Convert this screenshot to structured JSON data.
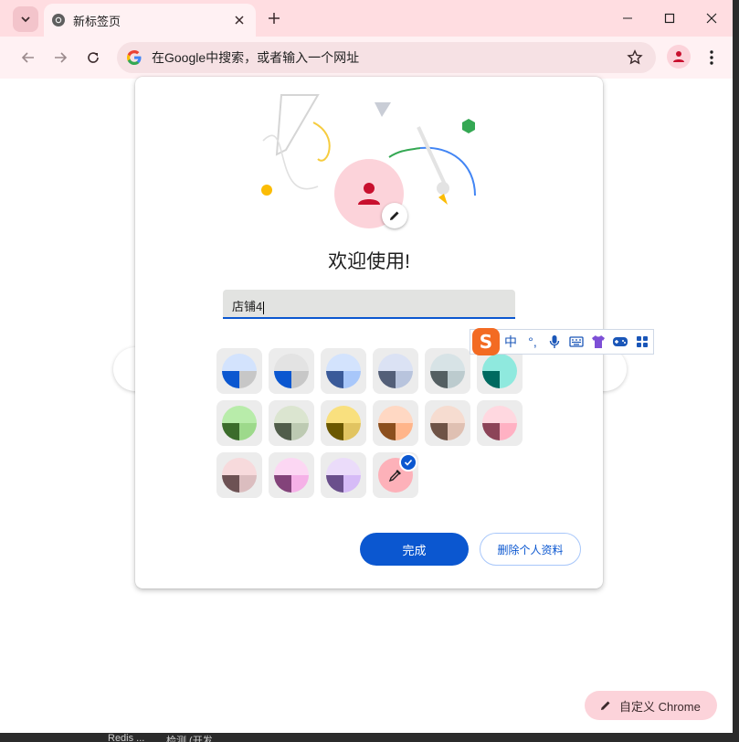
{
  "browser": {
    "tab_title": "新标签页",
    "omnibox_placeholder": "在Google中搜索，或者输入一个网址"
  },
  "dialog": {
    "welcome": "欢迎使用!",
    "name_value": "店铺4",
    "done_label": "完成",
    "delete_label": "删除个人资料",
    "selected_swatch": "custom",
    "swatches": [
      {
        "tl": "#d3e3fd",
        "tr": "#d3e3fd",
        "bl": "#0b57d0",
        "br": "#c7c7c7"
      },
      {
        "tl": "#e3e3e3",
        "tr": "#e3e3e3",
        "bl": "#0b57d0",
        "br": "#c7c7c7"
      },
      {
        "tl": "#d3e3fd",
        "tr": "#d3e3fd",
        "bl": "#3a5a99",
        "br": "#a8c7fa"
      },
      {
        "tl": "#dbe2f4",
        "tr": "#dbe2f4",
        "bl": "#535f78",
        "br": "#b8c4dd"
      },
      {
        "tl": "#d7e3e6",
        "tr": "#d7e3e6",
        "bl": "#545f62",
        "br": "#bccbce"
      },
      {
        "tl": "#8fe9de",
        "tr": "#8fe9de",
        "bl": "#006a60",
        "br": "#8fe9de"
      },
      {
        "tl": "#b8ecaa",
        "tr": "#b8ecaa",
        "bl": "#3b6c2b",
        "br": "#9dd98b"
      },
      {
        "tl": "#dbe5d0",
        "tr": "#dbe5d0",
        "bl": "#515d4b",
        "br": "#bdcab2"
      },
      {
        "tl": "#f9e07e",
        "tr": "#f9e07e",
        "bl": "#6b5800",
        "br": "#e1c461"
      },
      {
        "tl": "#ffd8c3",
        "tr": "#ffd8c3",
        "bl": "#8c4f1d",
        "br": "#ffb58a"
      },
      {
        "tl": "#f6dcd0",
        "tr": "#f6dcd0",
        "bl": "#6f5346",
        "br": "#dfc0b2"
      },
      {
        "tl": "#ffd8e0",
        "tr": "#ffd8e0",
        "bl": "#8c4458",
        "br": "#ffb1c3"
      },
      {
        "tl": "#f7dadc",
        "tr": "#f7dadc",
        "bl": "#6d5254",
        "br": "#dbbdbf"
      },
      {
        "tl": "#fcd7f3",
        "tr": "#fcd7f3",
        "bl": "#83437a",
        "br": "#f5b1e7"
      },
      {
        "tl": "#ebdcfa",
        "tr": "#ebdcfa",
        "bl": "#6a4f8c",
        "br": "#d6bbf7"
      }
    ]
  },
  "ime": {
    "logo": "S",
    "mode": "中",
    "punct": "°,",
    "icons": [
      "mic-icon",
      "keyboard-icon",
      "skin-icon",
      "game-icon",
      "apps-icon"
    ]
  },
  "ntp": {
    "customize_label": "自定义 Chrome"
  },
  "taskbar": {
    "item1": "Redis ...",
    "item2": "检测 (开发..."
  },
  "colors": {
    "accent": "#0b57d0",
    "frame": "#ffdde1",
    "toolbar": "#fff1f3",
    "avatar": "#fcd3da",
    "avatar_icon": "#c8102e"
  }
}
